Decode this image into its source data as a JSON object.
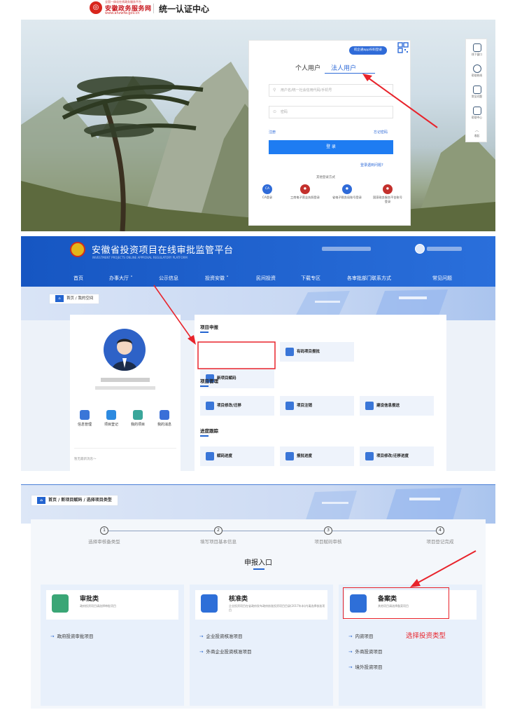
{
  "login_panel": {
    "site_tagline": "全国一体化在线政务服务平台",
    "site_name": "安徽政务服务网",
    "site_url": "www.ahzwfw.gov.cn",
    "auth_title": "统一认证中心",
    "scan_login": "皖企通app扫码登录",
    "tabs": [
      "个人用户",
      "法人用户"
    ],
    "active_tab": "法人用户",
    "username_placeholder": "用户名/统一社会信用代码/手机号",
    "password_placeholder": "密码",
    "register": "注册",
    "forgot_password": "忘记密码",
    "login_button": "登 录",
    "login_trouble": "登录遇到问题?",
    "other_login_title": "其他登录方式",
    "other_logins": [
      {
        "label": "CA登录",
        "icon": "ca-icon",
        "color": "#2f6bd8"
      },
      {
        "label": "工商电子营业执照登录",
        "icon": "license-icon",
        "color": "#c3302c"
      },
      {
        "label": "省电子税务局账号登录",
        "icon": "tax-icon",
        "color": "#2f6bd8"
      },
      {
        "label": "国家政务服务平台账号登录",
        "icon": "national-icon",
        "color": "#c3302c"
      }
    ],
    "side_tools": [
      "线下窗口",
      "帮助热线",
      "常见问题",
      "帮助中心",
      "收起"
    ]
  },
  "platform_panel": {
    "title": "安徽省投资项目在线审批监管平台",
    "subtitle": "INVESTMENT PROJECTS ONLINE APPROVAL REGULATORY PLATFORM",
    "nav": [
      "首页",
      "办事大厅 ˅",
      "公示信息",
      "投资安徽 ˅",
      "民间投资",
      "下载专区",
      "各审批部门联系方式",
      "常见问题"
    ],
    "breadcrumb": "首页 / 我的空间",
    "profile_actions": [
      "信息管理",
      "项目登记",
      "我的项目",
      "我的消息"
    ],
    "no_news": "暂无最新消息～",
    "sections": [
      {
        "title": "项目申报",
        "items": [
          "新项目赋码",
          "有码项目报批"
        ]
      },
      {
        "title": "项目管理",
        "items": [
          "项目修改/迁移",
          "项目注销",
          "建设信息报送"
        ]
      },
      {
        "title": "进度跟踪",
        "items": [
          "赋码进度",
          "报批进度",
          "项目修改/迁移进度"
        ]
      }
    ]
  },
  "type_panel": {
    "breadcrumb": "首页 / 新项目赋码 / 选择项目类型",
    "steps": [
      {
        "num": "1",
        "label": "选择审核备类型"
      },
      {
        "num": "2",
        "label": "填写项目基本信息"
      },
      {
        "num": "3",
        "label": "项目赋码审核"
      },
      {
        "num": "4",
        "label": "项目登记完成"
      }
    ],
    "entry_title": "申报入口",
    "types": [
      {
        "name": "审批类",
        "desc": "政府投资项目请选择审批项目",
        "links": [
          "政府投资审批项目"
        ]
      },
      {
        "name": "核准类",
        "desc": "企业投资项目在省政府发布政府核准投资项目目录(2017年本)内请选择核准项目",
        "links": [
          "企业投资核准项目",
          "外商企业投资核准项目"
        ]
      },
      {
        "name": "备案类",
        "desc": "其他项目请选择备案项目",
        "links": [
          "内资项目",
          "外商投资项目",
          "境外投资项目"
        ]
      }
    ],
    "annotation": "选择投资类型"
  },
  "colors": {
    "primary": "#1e7cf2",
    "nav": "#1656c2",
    "highlight": "#e8232b"
  }
}
